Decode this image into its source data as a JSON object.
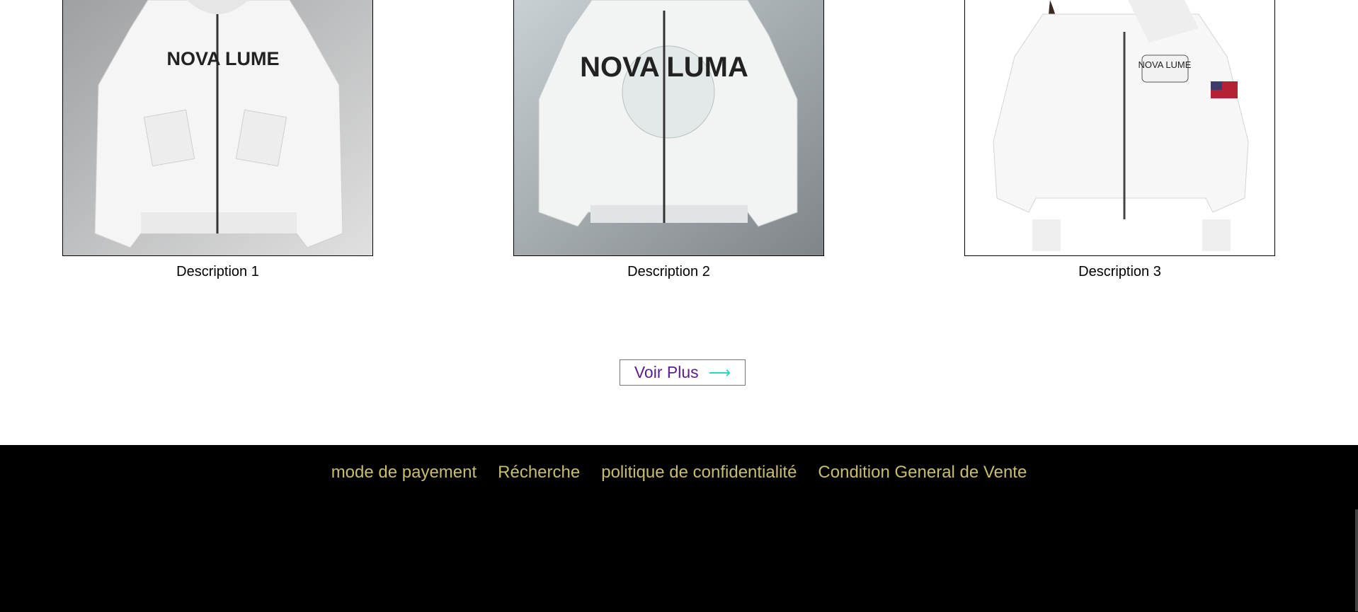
{
  "products": [
    {
      "caption": "Description 1",
      "image_icon": "white-bomber-jacket-image",
      "brand_print": "NOVA LUME"
    },
    {
      "caption": "Description 2",
      "image_icon": "white-bomber-jacket-image",
      "brand_print": "NOVA LUMA"
    },
    {
      "caption": "Description 3",
      "image_icon": "model-white-jacket-image",
      "brand_print": "NOVA LUME"
    }
  ],
  "more_button": {
    "label": "Voir Plus",
    "arrow": "⟶"
  },
  "footer": {
    "links": [
      "mode de payement",
      "Récherche",
      "politique de confidentialité",
      "Condition General de Vente"
    ]
  },
  "colors": {
    "footer_bg": "#000000",
    "footer_link": "#c8bd6d",
    "button_text": "#5a1e8c",
    "arrow": "#2fd3c8"
  }
}
